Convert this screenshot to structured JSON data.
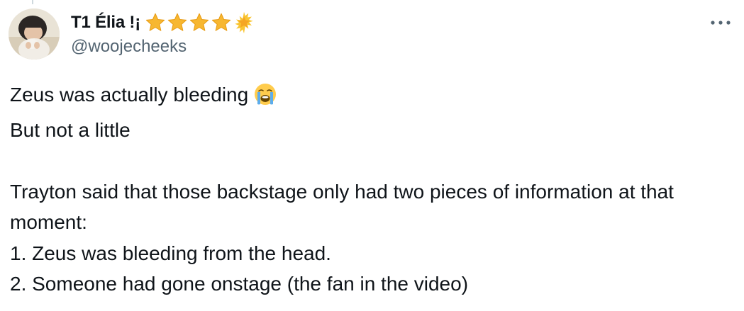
{
  "author": {
    "display_name": "T1 Élia !¡",
    "handle": "@woojecheeks",
    "badge_icons": [
      "star-icon",
      "star-icon",
      "star-icon",
      "star-icon",
      "sparkle-star-icon"
    ],
    "avatar_icon": "profile-avatar"
  },
  "menu": {
    "more_icon": "more-options-icon",
    "more_label": "···"
  },
  "tweet": {
    "lines": [
      "Zeus was actually bleeding",
      "But not a little",
      "Trayton said that those backstage only had two pieces of information at that moment:",
      "1. Zeus was bleeding from the head.",
      "2. Someone had gone onstage (the fan in the video)"
    ],
    "emoji_icon": "loudly-crying-face-icon"
  },
  "colors": {
    "text": "#0f1419",
    "secondary_text": "#536471",
    "star": "#f7b731",
    "background": "#ffffff"
  }
}
